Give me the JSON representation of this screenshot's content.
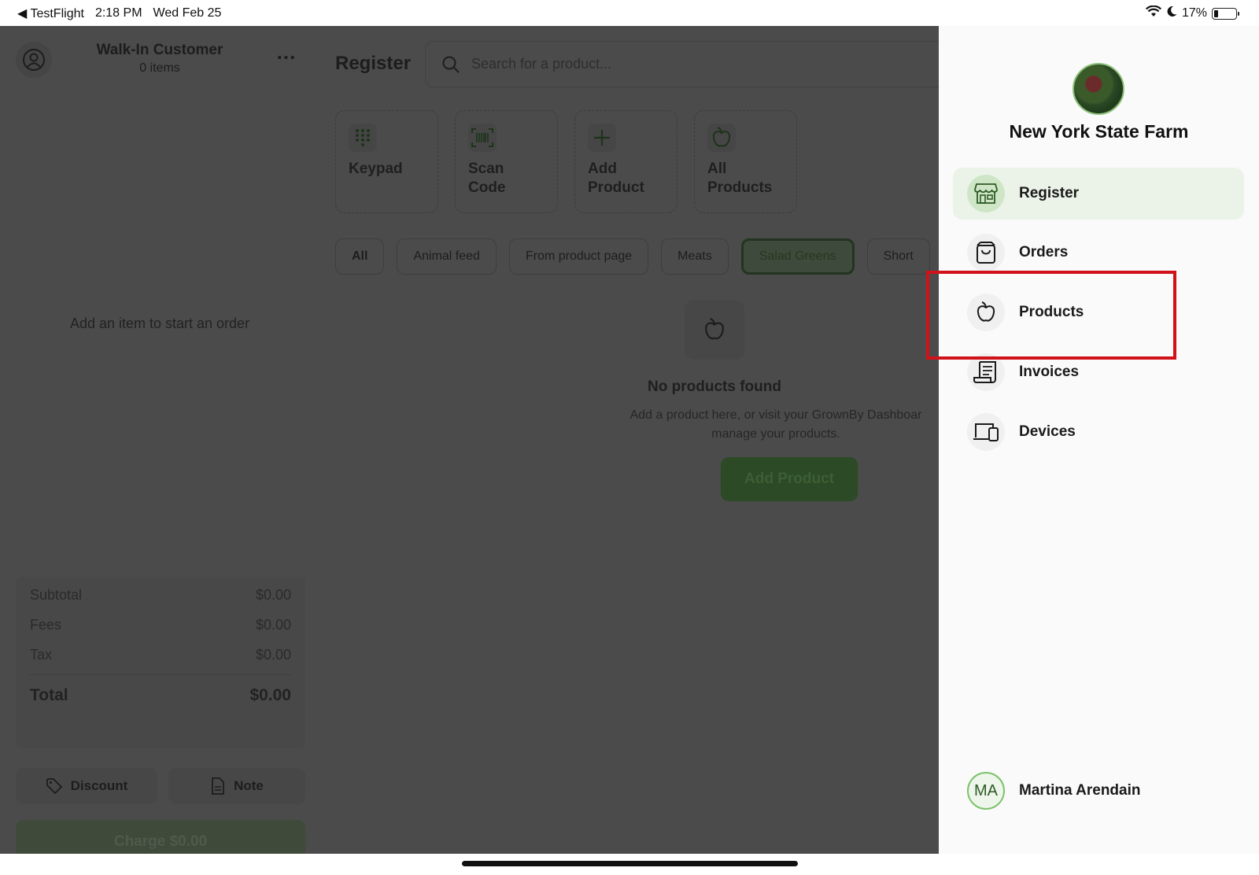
{
  "status_bar": {
    "back_app": "◀ TestFlight",
    "time": "2:18 PM",
    "date": "Wed Feb 25",
    "battery": "17%",
    "battery_level": 0.17
  },
  "cart": {
    "customer_name": "Walk-In Customer",
    "item_count": "0 items",
    "empty_message": "Add an item to start an order",
    "summary": {
      "subtotal_label": "Subtotal",
      "subtotal_value": "$0.00",
      "fees_label": "Fees",
      "fees_value": "$0.00",
      "tax_label": "Tax",
      "tax_value": "$0.00",
      "total_label": "Total",
      "total_value": "$0.00"
    },
    "discount_label": "Discount",
    "note_label": "Note",
    "charge_label": "Charge $0.00"
  },
  "register": {
    "title": "Register",
    "search_placeholder": "Search for a product...",
    "tiles": [
      {
        "line1": "Keypad",
        "line2": "",
        "icon": "keypad-icon"
      },
      {
        "line1": "Scan",
        "line2": "Code",
        "icon": "barcode-icon"
      },
      {
        "line1": "Add",
        "line2": "Product",
        "icon": "plus-icon"
      },
      {
        "line1": "All",
        "line2": "Products",
        "icon": "apple-icon"
      }
    ],
    "chips": [
      "All",
      "Animal feed",
      "From product page",
      "Meats",
      "Salad Greens",
      "Short"
    ],
    "active_chip": "Salad Greens",
    "empty_title": "No products found",
    "empty_desc_line1": "Add a product here, or visit your GrownBy Dashboar",
    "empty_desc_line2": "manage your products.",
    "add_product_button": "Add Product"
  },
  "drawer": {
    "farm_name": "New York State Farm",
    "nav": [
      {
        "label": "Register",
        "icon": "storefront-icon",
        "active": true
      },
      {
        "label": "Orders",
        "icon": "shopping-bag-icon",
        "active": false
      },
      {
        "label": "Products",
        "icon": "apple-icon",
        "active": false
      },
      {
        "label": "Invoices",
        "icon": "invoice-icon",
        "active": false
      },
      {
        "label": "Devices",
        "icon": "devices-icon",
        "active": false
      }
    ],
    "user_initials": "MA",
    "user_name": "Martina Arendain"
  },
  "colors": {
    "accent_green": "#2d5a26",
    "active_nav_bg": "#ebf3e8",
    "highlight_red": "#d1121a",
    "overlay_dim": "#4b4b4b"
  }
}
